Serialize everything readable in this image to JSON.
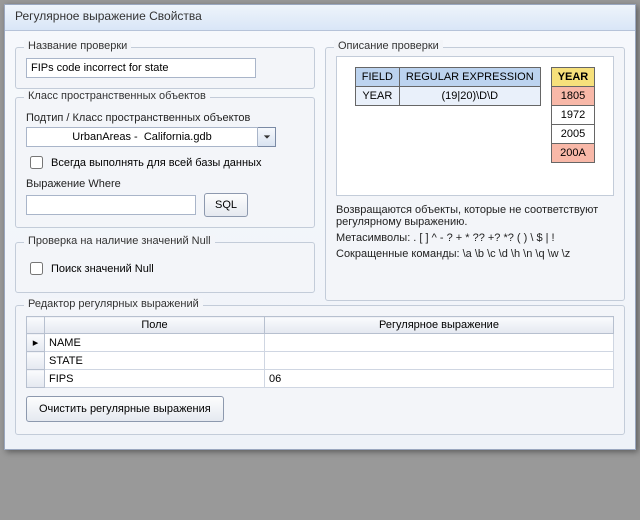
{
  "window": {
    "title": "Регулярное выражение Свойства"
  },
  "checkName": {
    "label": "Название проверки",
    "value": "FIPs code incorrect for state"
  },
  "featureClass": {
    "label": "Класс пространственных объектов",
    "sublabel": "Подтип / Класс пространственных объектов",
    "value": "UrbanAreas -  California.gdb",
    "alwaysWholeDb": "Всегда выполнять для всей базы данных",
    "whereLabel": "Выражение Where",
    "whereValue": "",
    "sqlButton": "SQL"
  },
  "nullCheck": {
    "legend": "Проверка на наличие значений Null",
    "checkbox": "Поиск значений Null"
  },
  "description": {
    "legend": "Описание проверки",
    "example": {
      "head_field": "FIELD",
      "head_regex": "REGULAR EXPRESSION",
      "row_field": "YEAR",
      "row_regex": "(19|20)\\D\\D"
    },
    "values": {
      "head": "YEAR",
      "rows": [
        "1805",
        "1972",
        "2005",
        "200A"
      ],
      "bad": [
        true,
        false,
        false,
        true
      ]
    },
    "returns": "Возвращаются объекты, которые не соответствуют регулярному выражению.",
    "meta": "Метасимволы: . [ ] ^ - ? + * ?? +? *? ( ) \\ $ | !",
    "shorthand": "Сокращенные команды: \\a \\b \\c \\d \\h \\n \\q \\w \\z"
  },
  "editor": {
    "legend": "Редактор регулярных выражений",
    "col_field": "Поле",
    "col_regex": "Регулярное выражение",
    "rows": [
      {
        "marker": "▸",
        "field": "NAME",
        "regex": ""
      },
      {
        "marker": "",
        "field": "STATE",
        "regex": ""
      },
      {
        "marker": "",
        "field": "FIPS",
        "regex": "06"
      }
    ],
    "clear": "Очистить регулярные выражения"
  }
}
